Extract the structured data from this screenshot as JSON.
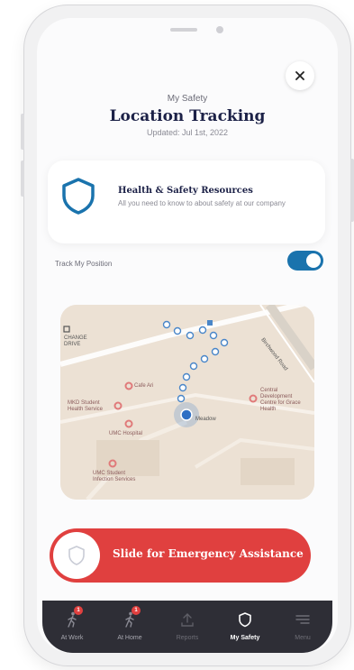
{
  "header": {
    "eyebrow": "My Safety",
    "title": "Location Tracking",
    "updated": "Updated: Jul 1st, 2022"
  },
  "close_icon": "close-icon",
  "resources_card": {
    "icon": "shield-icon",
    "title": "Health & Safety Resources",
    "text": "All you need to know to about safety at our company"
  },
  "tracking": {
    "label": "Track My Position",
    "enabled": true
  },
  "map": {
    "labels": {
      "top_left": "CHANGE DRIVE",
      "cafe": "Cafe Ari",
      "student_health": "MKD Student Health Service",
      "umc_hospital": "UMC Hospital",
      "umc_student": "UMC Student Infection Services",
      "right_center": "Central Development Centre for Grace Health",
      "road": "Birchwood Road",
      "you": "Meadow"
    }
  },
  "emergency": {
    "label": "Slide for Emergency Assistance",
    "icon": "shield-icon"
  },
  "tabs": [
    {
      "label": "At Work",
      "icon": "walk-icon",
      "badge": "1"
    },
    {
      "label": "At Home",
      "icon": "walk-icon",
      "badge": "1"
    },
    {
      "label": "Reports",
      "icon": "upload-icon"
    },
    {
      "label": "My Safety",
      "icon": "shield-icon"
    },
    {
      "label": "Menu",
      "icon": "menu-icon"
    }
  ],
  "colors": {
    "accent_blue": "#1a73ad",
    "emergency_red": "#e0403f",
    "navy": "#1c2147",
    "tabbar": "#2e2e36"
  }
}
